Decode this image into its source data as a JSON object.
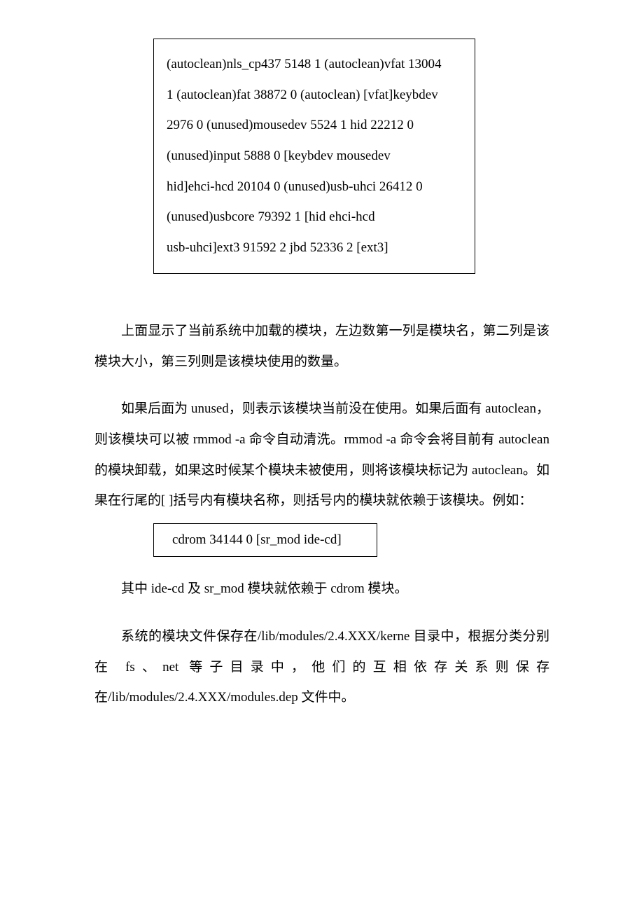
{
  "codebox1": {
    "l1": "(autoclean)nls_cp437 5148 1 (autoclean)vfat 13004",
    "l2": "1 (autoclean)fat 38872 0 (autoclean) [vfat]keybdev",
    "l3": "2976 0 (unused)mousedev 5524 1 hid 22212 0",
    "l4": "(unused)input 5888 0 [keybdev mousedev",
    "l5": "hid]ehci-hcd 20104 0 (unused)usb-uhci 26412 0",
    "l6": "(unused)usbcore 79392 1 [hid ehci-hcd",
    "l7": "usb-uhci]ext3 91592 2 jbd 52336 2 [ext3]"
  },
  "para1": "上面显示了当前系统中加载的模块，左边数第一列是模块名，第二列是该模块大小，第三列则是该模块使用的数量。",
  "para2": "如果后面为 unused，则表示该模块当前没在使用。如果后面有 autoclean，则该模块可以被 rmmod -a 命令自动清洗。rmmod -a 命令会将目前有 autoclean 的模块卸载，如果这时候某个模块未被使用，则将该模块标记为 autoclean。如果在行尾的[ ]括号内有模块名称，则括号内的模块就依赖于该模块。例如：",
  "codebox2": "cdrom 34144 0 [sr_mod ide-cd]",
  "para3": "其中 ide-cd 及 sr_mod 模块就依赖于 cdrom 模块。",
  "para4": "系统的模块文件保存在/lib/modules/2.4.XXX/kerne 目录中，根据分类分别在 fs、net 等子目录中，他们的互相依存关系则保存在/lib/modules/2.4.XXX/modules.dep  文件中。"
}
